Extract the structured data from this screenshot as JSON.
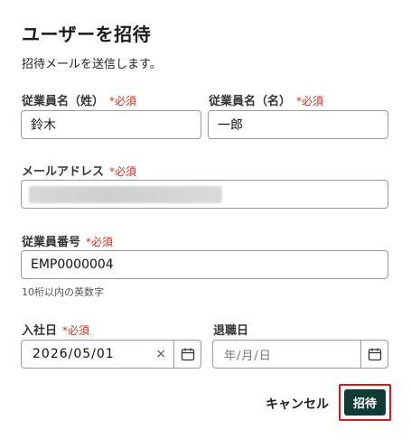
{
  "dialog": {
    "title": "ユーザーを招待",
    "subtitle": "招待メールを送信します。"
  },
  "required_mark": "*必須",
  "fields": {
    "last_name": {
      "label": "従業員名（姓）",
      "value": "鈴木"
    },
    "first_name": {
      "label": "従業員名（名）",
      "value": "一郎"
    },
    "email": {
      "label": "メールアドレス",
      "value": ""
    },
    "employee_number": {
      "label": "従業員番号",
      "value": "EMP0000004",
      "hint": "10桁以内の英数字"
    },
    "join_date": {
      "label": "入社日",
      "value": "2026/05/01"
    },
    "leave_date": {
      "label": "退職日",
      "placeholder": "年/月/日"
    }
  },
  "icons": {
    "clear": "×",
    "calendar": "calendar-icon"
  },
  "buttons": {
    "cancel": "キャンセル",
    "invite": "招待"
  },
  "colors": {
    "required": "#c0392b",
    "primary": "#0f3b36",
    "highlight": "#e0141e"
  }
}
